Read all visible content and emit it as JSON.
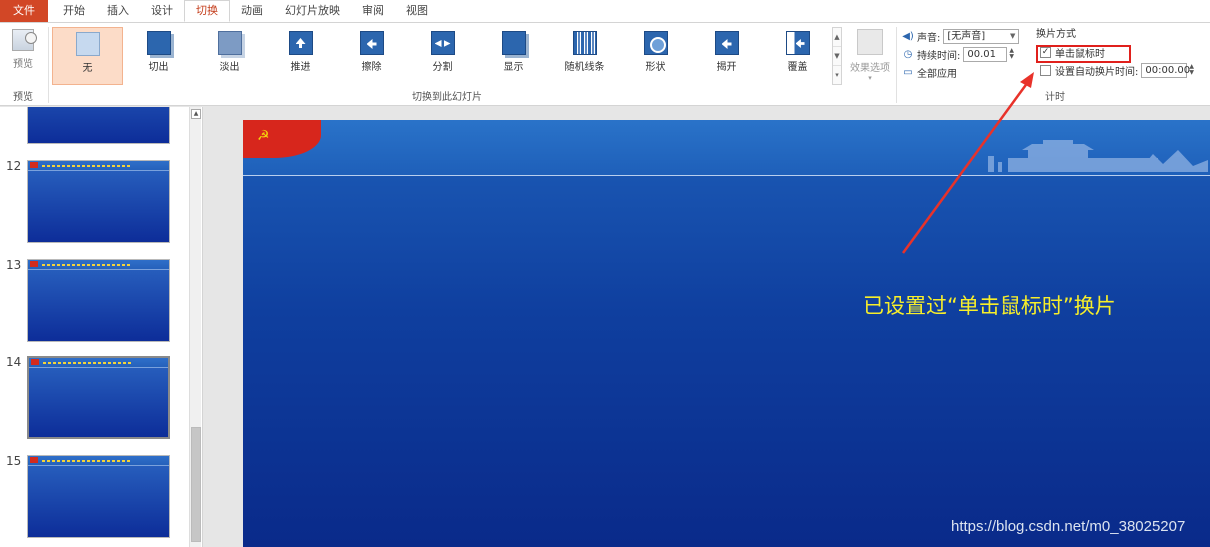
{
  "tabs": {
    "file": "文件",
    "items": [
      {
        "label": "开始"
      },
      {
        "label": "插入"
      },
      {
        "label": "设计"
      },
      {
        "label": "切换",
        "active": true
      },
      {
        "label": "动画"
      },
      {
        "label": "幻灯片放映"
      },
      {
        "label": "审阅"
      },
      {
        "label": "视图"
      }
    ]
  },
  "ribbon": {
    "preview": {
      "button": "预览",
      "group": "预览"
    },
    "gallery_group": "切换到此幻灯片",
    "effects": [
      {
        "label": "无",
        "icon": "none-icon",
        "selected": true
      },
      {
        "label": "切出",
        "icon": "cut-icon"
      },
      {
        "label": "淡出",
        "icon": "fade-icon"
      },
      {
        "label": "推进",
        "icon": "push-icon"
      },
      {
        "label": "擦除",
        "icon": "wipe-icon"
      },
      {
        "label": "分割",
        "icon": "split-icon"
      },
      {
        "label": "显示",
        "icon": "reveal-icon"
      },
      {
        "label": "随机线条",
        "icon": "random-bars-icon"
      },
      {
        "label": "形状",
        "icon": "shape-icon"
      },
      {
        "label": "揭开",
        "icon": "uncover-icon"
      },
      {
        "label": "覆盖",
        "icon": "cover-icon"
      }
    ],
    "effect_options": "效果选项",
    "timing": {
      "sound_label": "声音:",
      "sound_value": "[无声音]",
      "duration_label": "持续时间:",
      "duration_value": "00.01",
      "apply_all": "全部应用",
      "group": "计时"
    },
    "advance": {
      "title": "换片方式",
      "on_click": "单击鼠标时",
      "on_click_checked": true,
      "after": "设置自动换片时间:",
      "after_checked": false,
      "after_value": "00:00.00"
    }
  },
  "thumbnails": [
    {
      "number": ""
    },
    {
      "number": "12"
    },
    {
      "number": "13"
    },
    {
      "number": "14",
      "selected": true
    },
    {
      "number": "15"
    }
  ],
  "slide": {
    "annotation": "已设置过“单击鼠标时”换片",
    "watermark": "https://blog.csdn.net/m0_38025207"
  },
  "colors": {
    "accent": "#c43e1c",
    "file_tab": "#d24726",
    "highlight": "#e0201c",
    "annotation": "#f7ee2a",
    "slide_blue": "#0f3f9f"
  }
}
